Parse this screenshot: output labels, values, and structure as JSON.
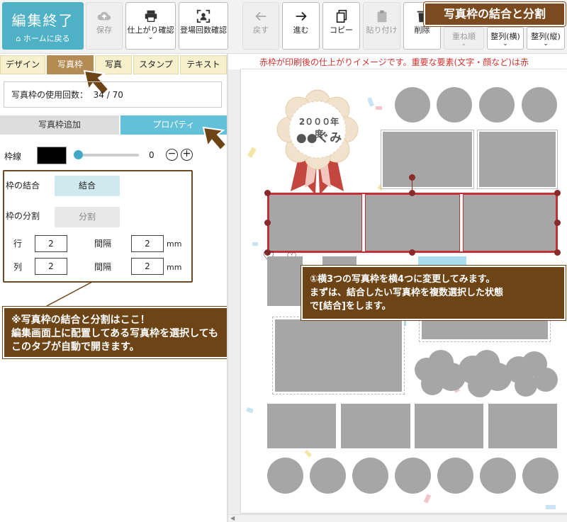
{
  "toolbar": {
    "edit_end": "編集終了",
    "home": "ホームに戻る",
    "save": "保存",
    "preview": "仕上がり確認",
    "count": "登場回数確認",
    "back": "戻す",
    "forward": "進む",
    "copy": "コピー",
    "paste": "貼り付け",
    "delete": "削除",
    "order": "重ね順",
    "align_h": "整列(横)",
    "align_v": "整列(縦)"
  },
  "title_badge": "写真枠の結合と分割",
  "tabs": [
    "デザイン",
    "写真枠",
    "写真",
    "スタンプ",
    "テキスト"
  ],
  "usage": {
    "label": "写真枠の使用回数：",
    "value": "34 / 70"
  },
  "subtabs": {
    "add": "写真枠追加",
    "property": "プロパティ"
  },
  "frame_line": {
    "label": "枠線",
    "value": "0",
    "color": "#000000"
  },
  "merge": {
    "label": "枠の結合",
    "button": "結合"
  },
  "split": {
    "label": "枠の分割",
    "button": "分割"
  },
  "grid": {
    "row_label": "行",
    "row_value": "2",
    "col_label": "列",
    "col_value": "2",
    "gap_label": "間隔",
    "gap_row": "2",
    "gap_col": "2",
    "unit": "mm"
  },
  "notice": "赤枠が印刷後の仕上がりイメージです。重要な要素(文字・顔など)は赤",
  "badge": {
    "line1": "2０００年度",
    "line2": "●●ぐみ"
  },
  "callout_left": [
    "※写真枠の結合と分割はここ！",
    "編集画面上に配置してある写真枠を選択しても",
    "このタブが自動で開きます。"
  ],
  "callout_right": [
    "①横3つの写真枠を横4つに変更してみます。",
    "まずは、結合したい写真枠を複数選択した状態",
    "で[結合]をします。"
  ],
  "colors": {
    "accent": "#4fb1c5",
    "brown": "#6d4415",
    "tab_active": "#b38b53",
    "notice_red": "#d0312d"
  }
}
